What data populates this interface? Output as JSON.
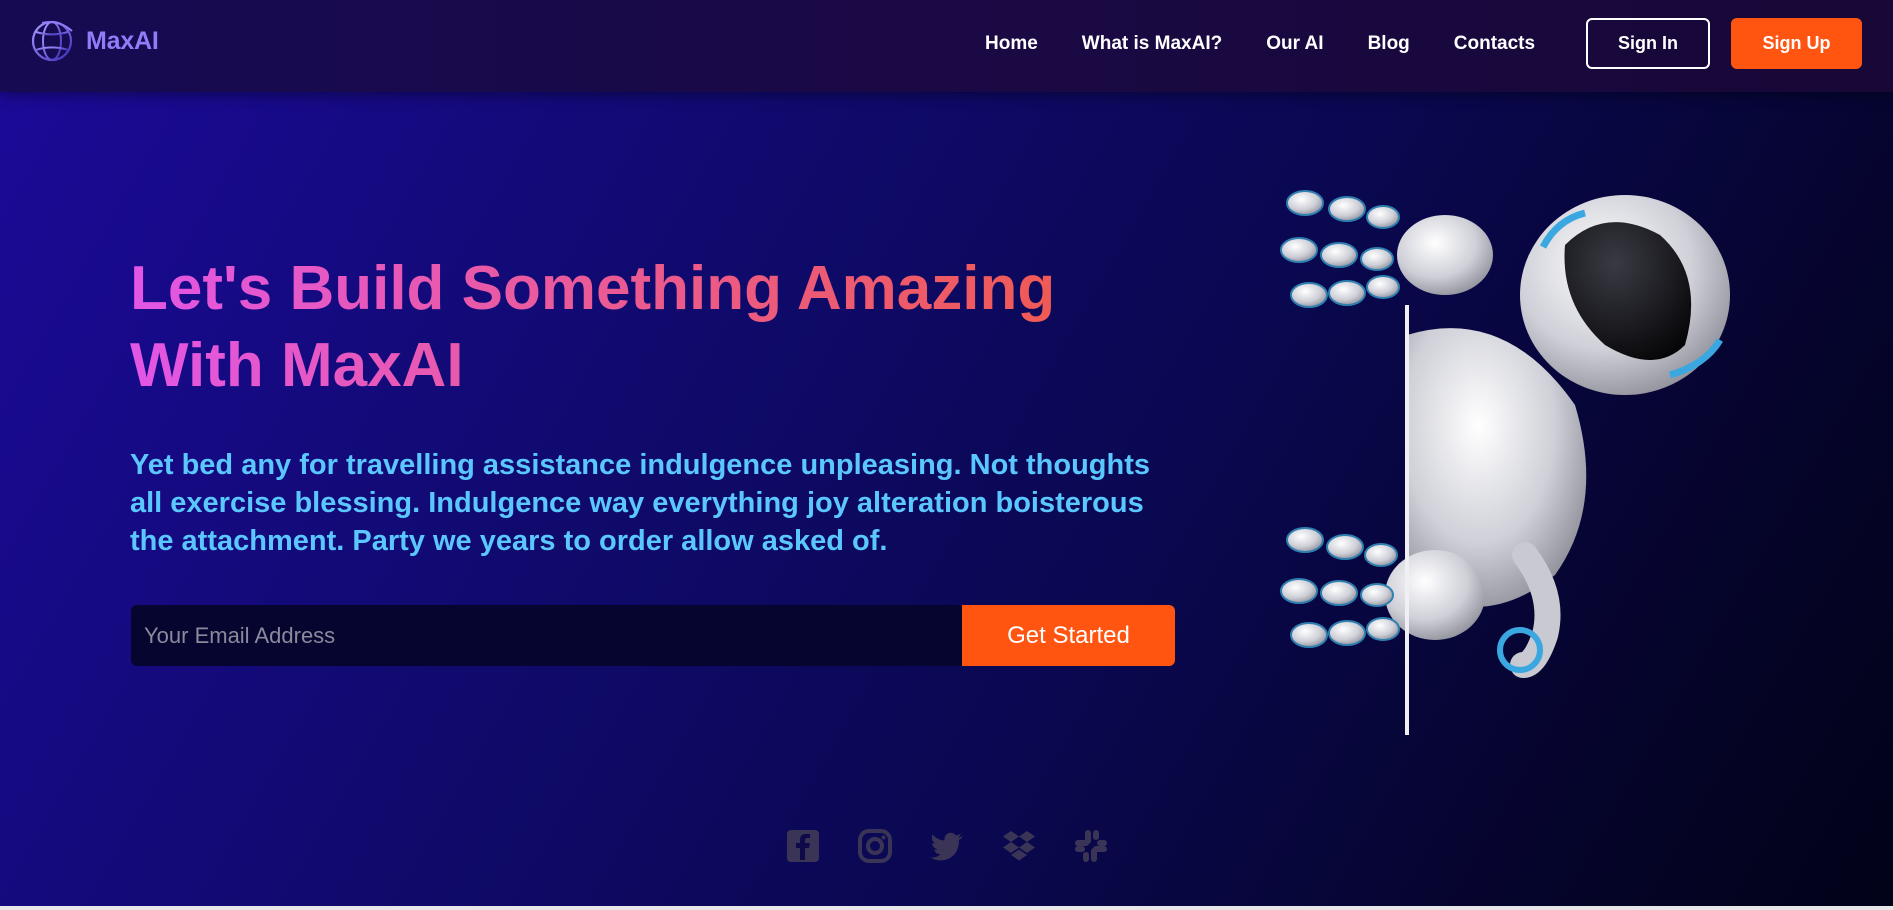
{
  "brand": {
    "name": "MaxAI"
  },
  "nav": {
    "items": [
      {
        "label": "Home"
      },
      {
        "label": "What is MaxAI?"
      },
      {
        "label": "Our AI"
      },
      {
        "label": "Blog"
      },
      {
        "label": "Contacts"
      }
    ],
    "sign_in": "Sign In",
    "sign_up": "Sign Up"
  },
  "hero": {
    "headline": "Let's Build Something Amazing With MaxAI",
    "subtext": "Yet bed any for travelling assistance indulgence unpleasing. Not thoughts all exercise blessing. Indulgence way everything joy alteration boisterous the attachment. Party we years to order allow asked of.",
    "email_placeholder": "Your Email Address",
    "email_value": "",
    "cta": "Get Started"
  },
  "social": [
    "facebook-icon",
    "instagram-icon",
    "twitter-icon",
    "dropbox-icon",
    "slack-icon"
  ],
  "colors": {
    "accent": "#ff5511",
    "subtext": "#5ac8ff",
    "logo": "#8f7cf7",
    "headline_gradient": [
      "#e256e6",
      "#f05a50"
    ]
  }
}
